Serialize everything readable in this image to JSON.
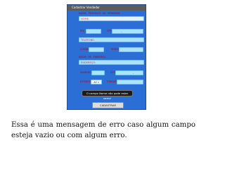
{
  "screen": {
    "title": "Cadastrar Vendedor",
    "section_personal": "DADOS PESSOAIS DO VENDEDOR",
    "section_address": "DADOS DE ENDEREÇO",
    "fields": {
      "nome_placeholder": "NOME:",
      "rg_label": "RG:",
      "cpf_label": "CPF:",
      "cpf_value": "-",
      "telefone_placeholder": "TELEFONE:",
      "login_label": "LOGIN:",
      "senha_label": "SENHA:",
      "endereco_placeholder": "ENDEREÇO:",
      "numero_label": "NÚMERO:",
      "cep_label": "CEP:",
      "cep_value": "-",
      "estado_label": "ESTADO:",
      "estado_value": "AC",
      "cidade_label": "CIDADE:"
    },
    "toast": "O campo Nome não pode estar vazio!",
    "submit_label": "CADASTRAR VENDEDOR"
  },
  "caption": "Essa é uma mensagem de erro caso algum campo esteja vazio ou com algum erro."
}
